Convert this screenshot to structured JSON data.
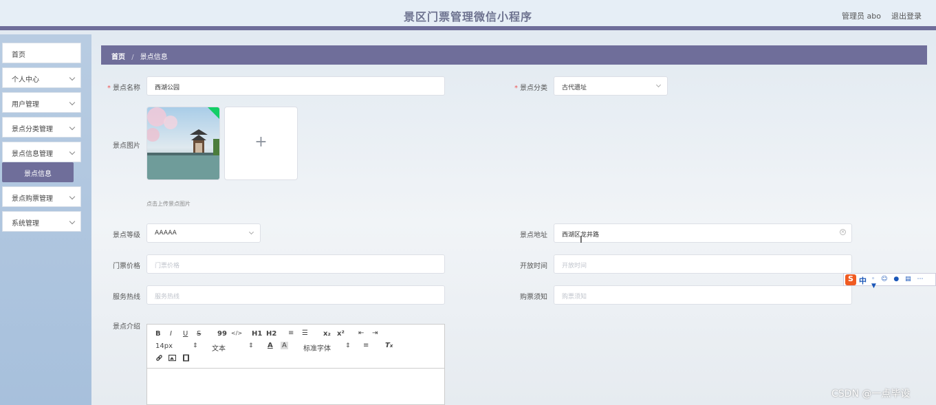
{
  "app": {
    "title": "景区门票管理微信小程序"
  },
  "header": {
    "admin": "管理员 abo",
    "logout": "退出登录"
  },
  "sidebar": {
    "items": [
      {
        "label": "首页",
        "expandable": false
      },
      {
        "label": "个人中心",
        "expandable": true
      },
      {
        "label": "用户管理",
        "expandable": true
      },
      {
        "label": "景点分类管理",
        "expandable": true
      },
      {
        "label": "景点信息管理",
        "expandable": true
      },
      {
        "label": "景点购票管理",
        "expandable": true
      },
      {
        "label": "系统管理",
        "expandable": true
      }
    ],
    "active_sub": "景点信息"
  },
  "breadcrumb": {
    "home": "首页",
    "separator": "/",
    "current": "景点信息"
  },
  "form": {
    "name": {
      "label": "景点名称",
      "value": "西湖公园",
      "required": true
    },
    "category": {
      "label": "景点分类",
      "value": "古代遗址",
      "required": true
    },
    "image": {
      "label": "景点图片",
      "tip": "点击上传景点图片",
      "add": "+"
    },
    "level": {
      "label": "景点等级",
      "value": "AAAAA"
    },
    "address": {
      "label": "景点地址",
      "value": "西湖区龙井路"
    },
    "price": {
      "label": "门票价格",
      "placeholder": "门票价格"
    },
    "open_time": {
      "label": "开放时间",
      "placeholder": "开放时间"
    },
    "hotline": {
      "label": "服务热线",
      "placeholder": "服务热线"
    },
    "notice": {
      "label": "购票须知",
      "placeholder": "购票须知"
    },
    "intro": {
      "label": "景点介绍"
    }
  },
  "editor": {
    "row1": [
      "B",
      "I",
      "U",
      "S",
      "99",
      "</>",
      "H1",
      "H2",
      "≡",
      "☰",
      "x₂",
      "x²",
      "⇤",
      "⇥"
    ],
    "font_size": "14px",
    "header": "文本",
    "font_family": "标准字体",
    "font_size_arrow": "⇕",
    "header_arrow": "⇕",
    "font_family_arrow": "⇕"
  },
  "ime": {
    "logo": "S",
    "lang": "中"
  },
  "watermark": "CSDN @一点毕设",
  "colors": {
    "accent": "#6f6e9a",
    "sidebar": "#a7c0dc",
    "required": "#e55555"
  },
  "icons": [
    "chevron-down-icon",
    "check-icon",
    "plus-icon",
    "clear-icon",
    "link-icon",
    "image-icon",
    "video-icon"
  ]
}
